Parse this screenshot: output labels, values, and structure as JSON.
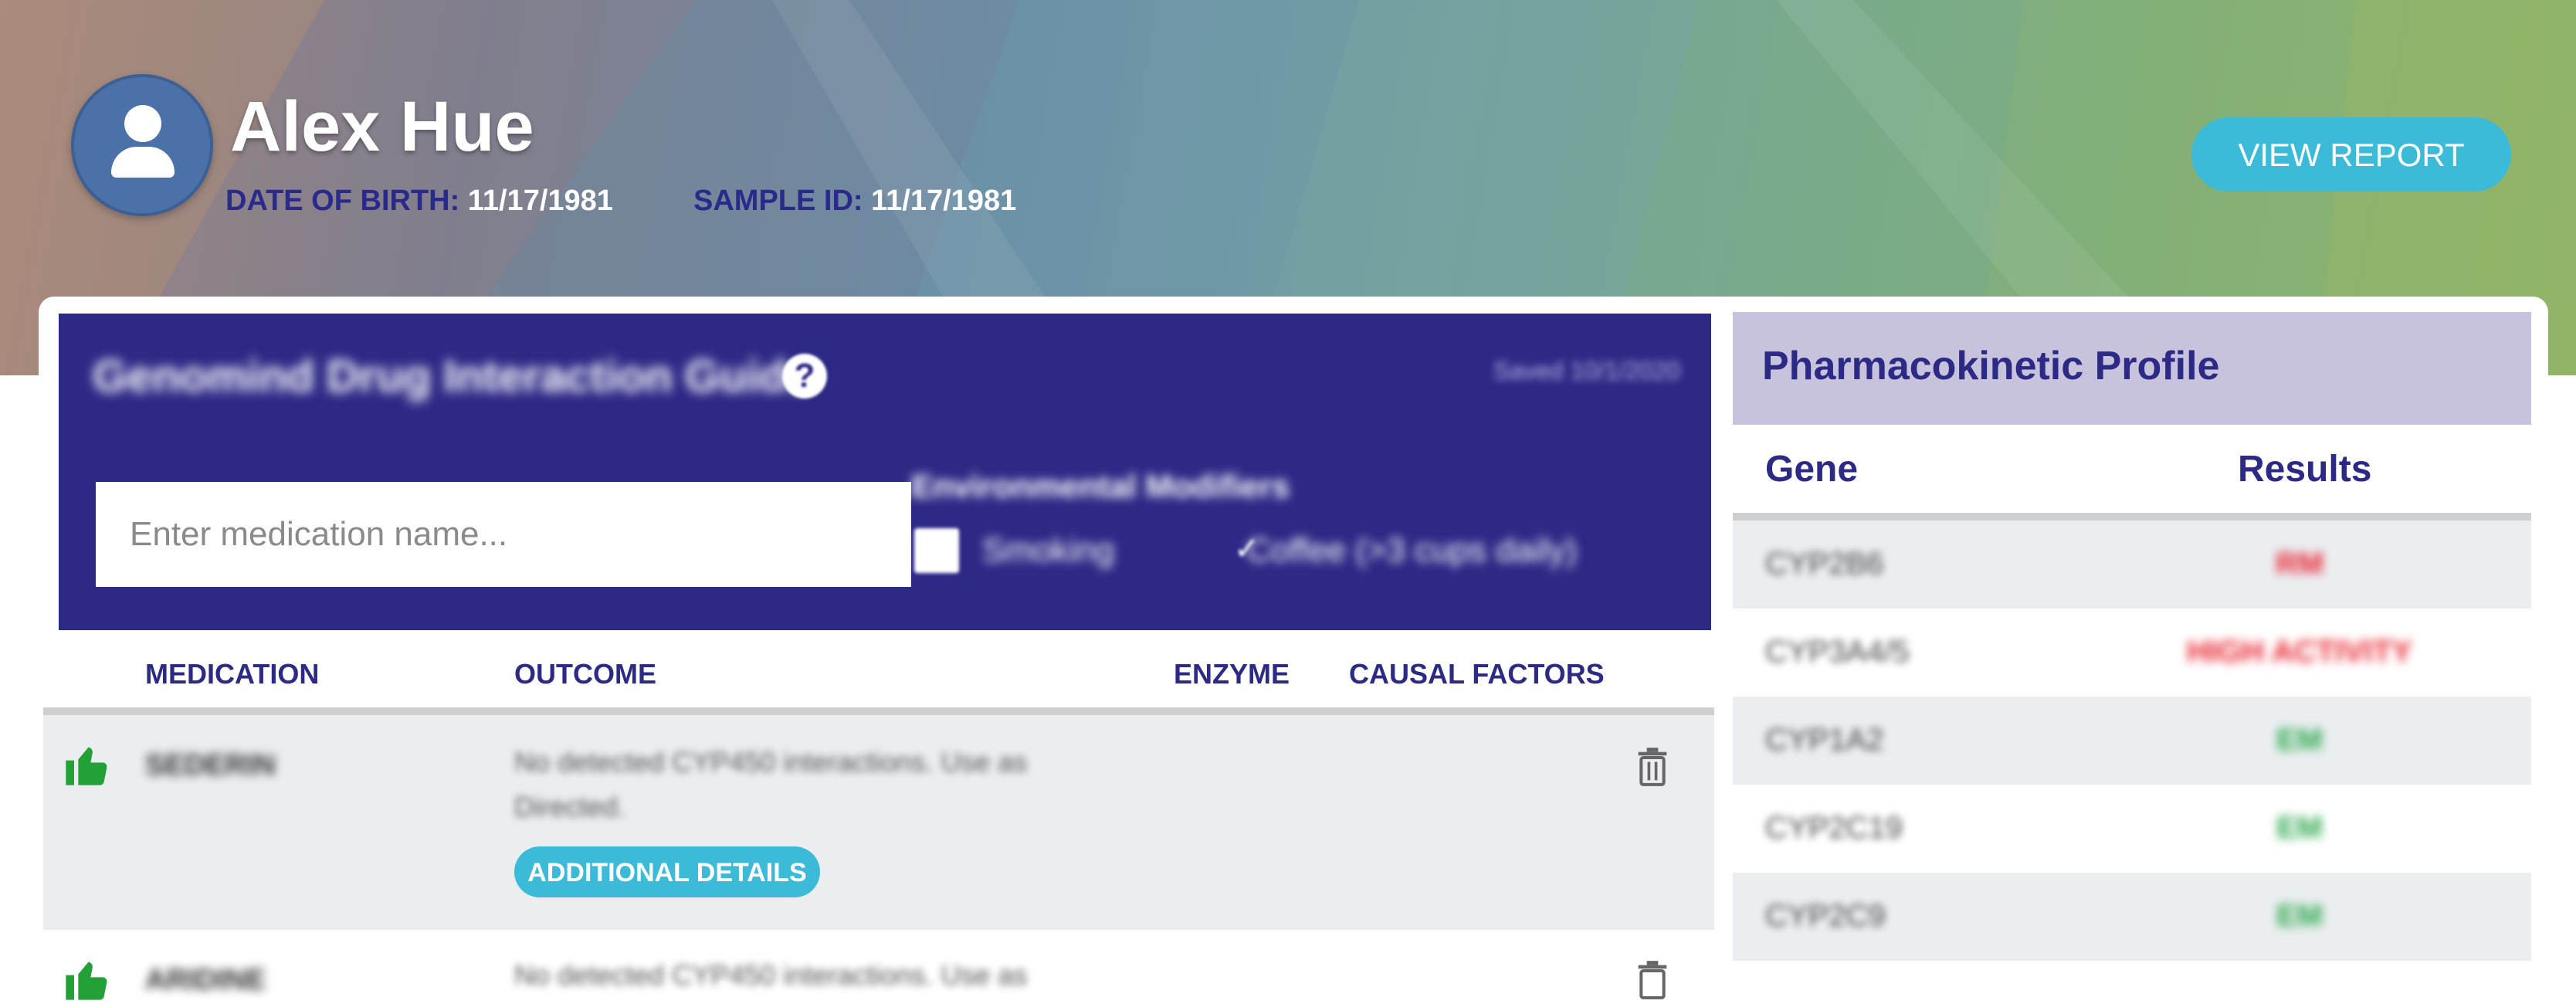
{
  "patient": {
    "name": "Alex Hue",
    "dob_label": "DATE OF BIRTH:",
    "dob_value": "11/17/1981",
    "sample_label": "SAMPLE ID:",
    "sample_value": "11/17/1981",
    "avatar_icon": "user-icon"
  },
  "header": {
    "view_report_label": "VIEW REPORT"
  },
  "guide": {
    "title": "Genomind Drug Interaction Guide",
    "help_icon": "?",
    "saved": "Saved 10/1/2020",
    "search_placeholder": "Enter medication name...",
    "env_title": "Environmental Modifiers",
    "modifiers": [
      {
        "label": "Smoking",
        "checked": false
      },
      {
        "label": "Coffee (>3 cups daily)",
        "checked": true
      }
    ],
    "checkmark": "✓"
  },
  "table": {
    "columns": [
      "MEDICATION",
      "OUTCOME",
      "ENZYME",
      "CAUSAL FACTORS"
    ],
    "rows": [
      {
        "medication": "SEDERIN",
        "outcome": "No detected CYP450 interactions. Use as Directed.",
        "details_label": "ADDITIONAL DETAILS",
        "status_icon": "thumbs-up-icon"
      },
      {
        "medication": "ARIDINE",
        "outcome": "No detected CYP450 interactions. Use as",
        "status_icon": "thumbs-up-icon"
      }
    ]
  },
  "pk": {
    "title": "Pharmacokinetic Profile",
    "col_gene": "Gene",
    "col_results": "Results",
    "rows": [
      {
        "gene": "CYP2B6",
        "result": "RM",
        "color": "#e8232f"
      },
      {
        "gene": "CYP3A4/5",
        "result": "HIGH ACTIVITY",
        "color": "#e8232f"
      },
      {
        "gene": "CYP1A2",
        "result": "EM",
        "color": "#2aa84a"
      },
      {
        "gene": "CYP2C19",
        "result": "EM",
        "color": "#2aa84a"
      },
      {
        "gene": "CYP2C9",
        "result": "EM",
        "color": "#2aa84a"
      }
    ]
  }
}
